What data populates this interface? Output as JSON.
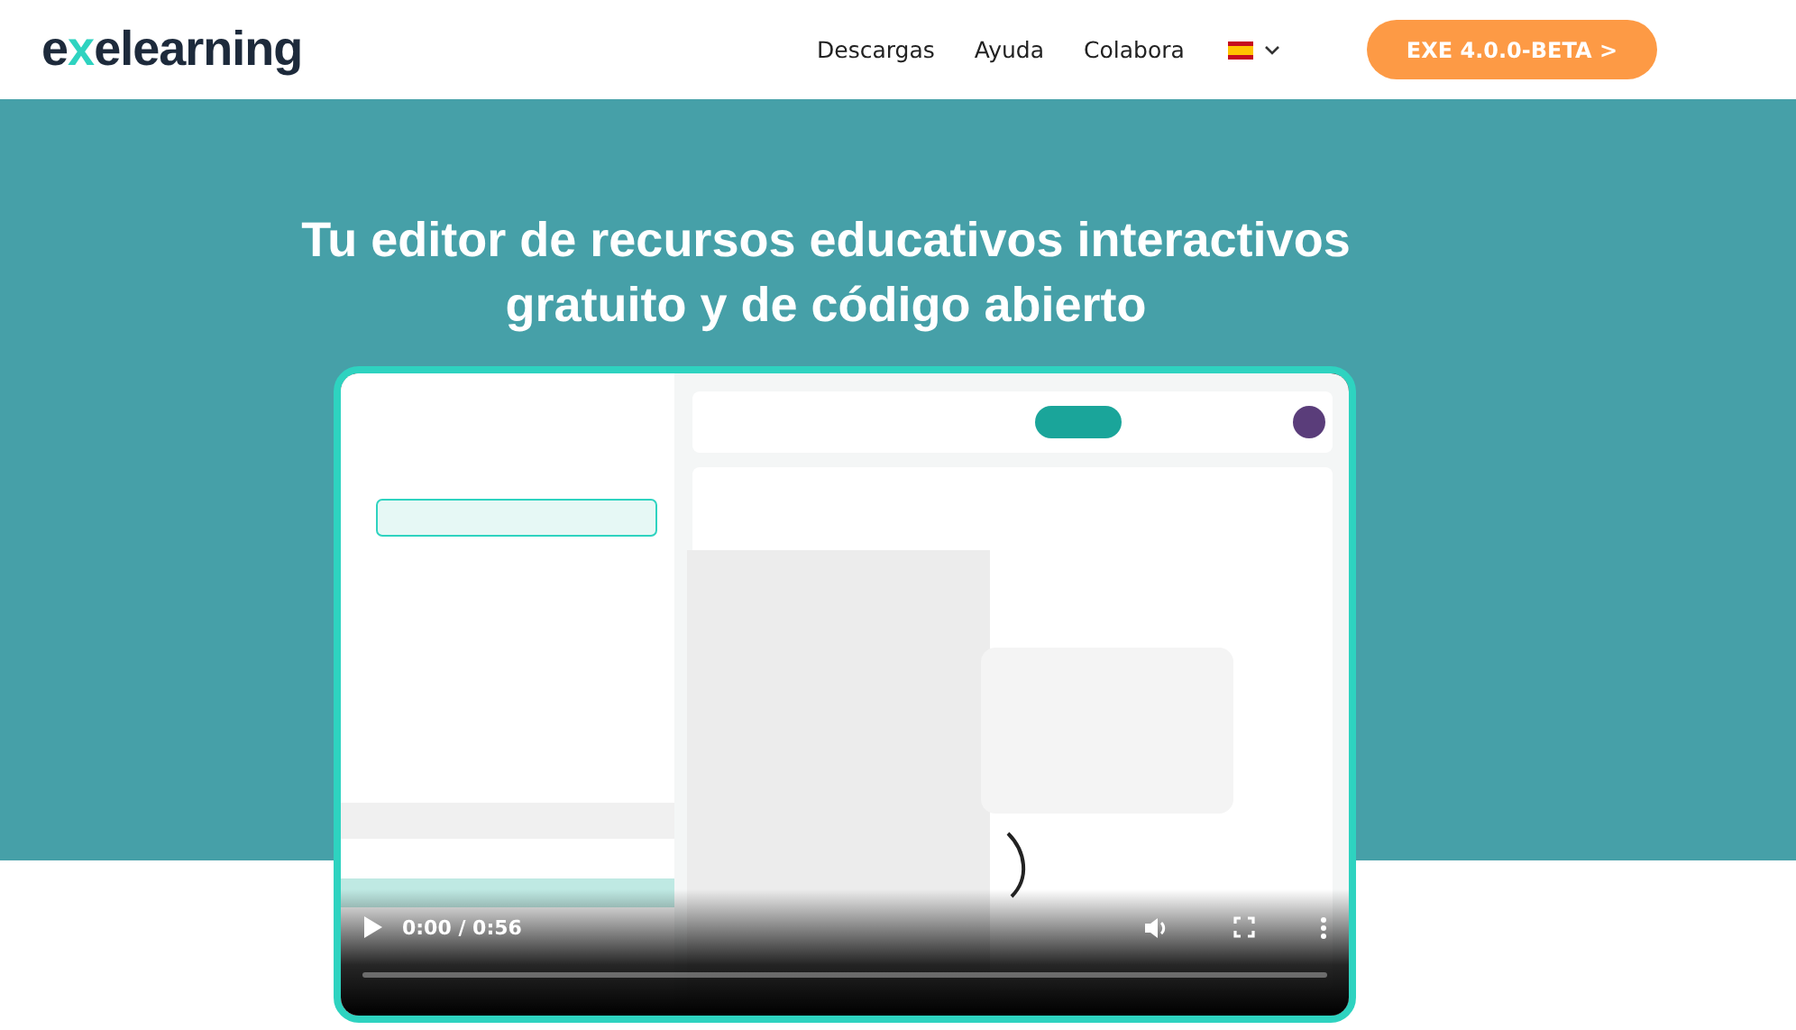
{
  "header": {
    "logo": [
      "e",
      "x",
      "elearning"
    ],
    "nav": [
      {
        "label": "Descargas"
      },
      {
        "label": "Ayuda"
      },
      {
        "label": "Colabora"
      }
    ],
    "cta": "EXE 4.0.0-BETA >"
  },
  "hero": {
    "title": "Tu editor de recursos educativos interactivos gratuito y de código abierto"
  },
  "video": {
    "time": "0:00 / 0:56",
    "level": 0
  }
}
